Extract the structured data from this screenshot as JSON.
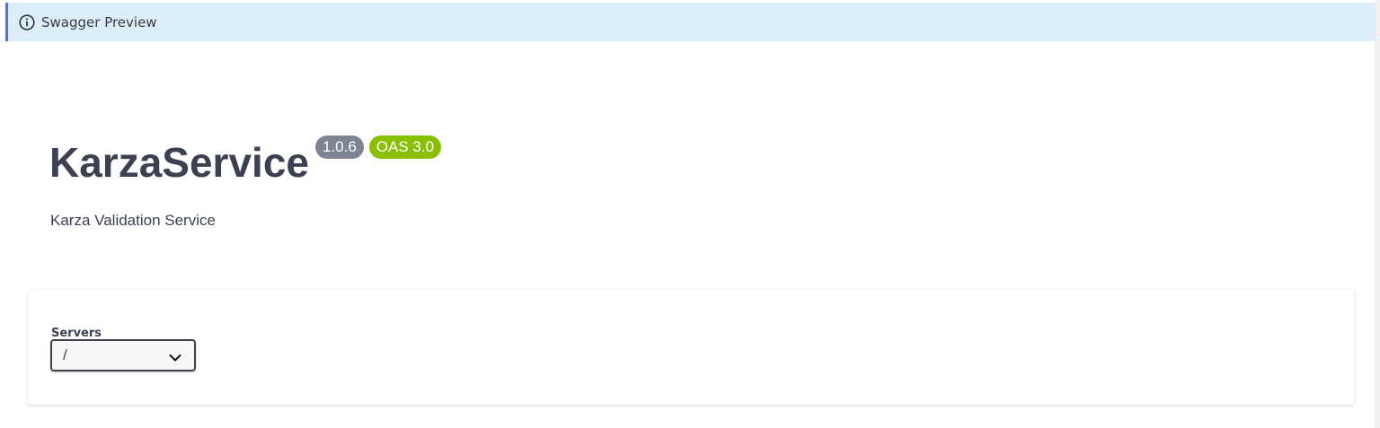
{
  "banner": {
    "icon": "info-icon",
    "text": "Swagger Preview"
  },
  "api": {
    "title": "KarzaService",
    "version": "1.0.6",
    "oas": "OAS 3.0",
    "description": "Karza Validation Service"
  },
  "servers": {
    "label": "Servers",
    "selected": "/",
    "icon": "chevron-down-icon"
  },
  "colors": {
    "banner_bg": "#ddeefb",
    "banner_accent": "#5b6ed6",
    "version_badge": "#7d8492",
    "oas_badge": "#89bf04",
    "text": "#3b4151"
  }
}
